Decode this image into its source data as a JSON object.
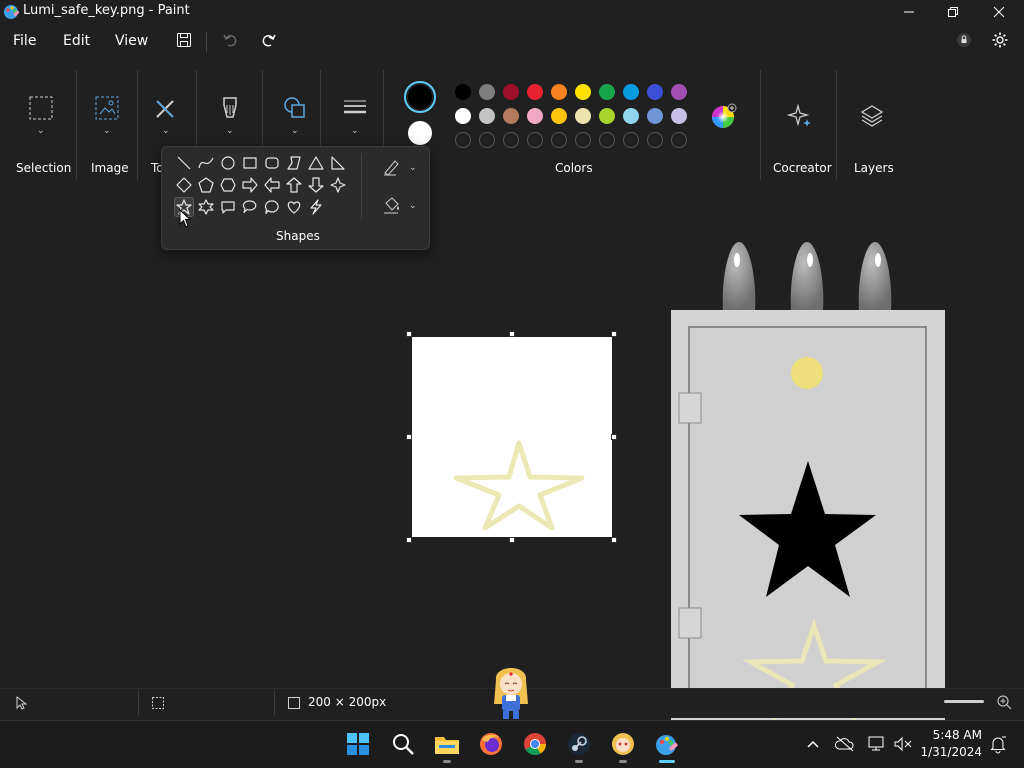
{
  "window": {
    "title": "Lumi_safe_key.png - Paint",
    "minimize_glyph": "—",
    "close_glyph": "✕"
  },
  "menu": {
    "file": "File",
    "edit": "Edit",
    "view": "View"
  },
  "ribbon": {
    "selection_label": "Selection",
    "image_label": "Image",
    "tools_label_partial": "To",
    "colors_label": "Colors",
    "cocreator_label": "Cocreator",
    "layers_label": "Layers"
  },
  "shapes_flyout": {
    "label": "Shapes",
    "selected_shape": "four-point-star"
  },
  "colors": {
    "primary": "#000000",
    "secondary": "#ffffff",
    "row1": [
      "#000000",
      "#7f7f7f",
      "#a0102a",
      "#e8222e",
      "#f7821f",
      "#ffe100",
      "#19a54b",
      "#0a9be0",
      "#3d4ed8",
      "#a24fb3"
    ],
    "row2": [
      "#ffffff",
      "#c3c3c3",
      "#b57a5e",
      "#f2a8c4",
      "#ffc40c",
      "#efe4b0",
      "#a6d42a",
      "#8fd3ee",
      "#6e95d6",
      "#c8bfe7"
    ],
    "row3_empty_count": 10,
    "accent": "#60cdff"
  },
  "status": {
    "canvas_size": "200 × 200px"
  },
  "taskbar": {
    "time": "5:48 AM",
    "date": "1/31/2024"
  }
}
